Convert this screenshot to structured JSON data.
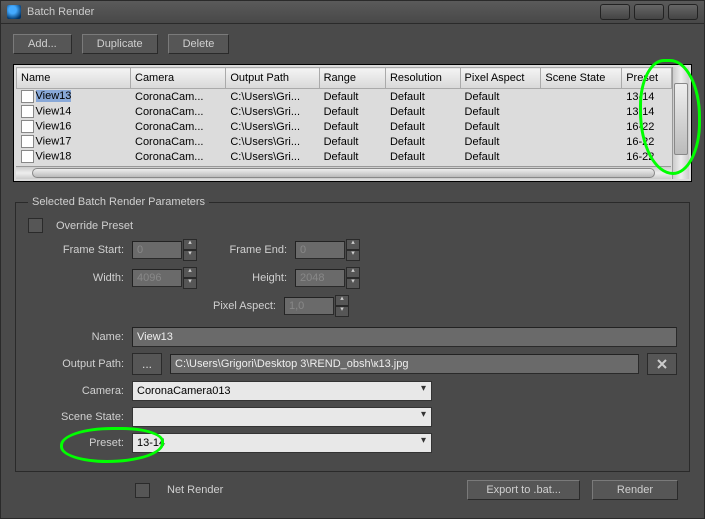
{
  "window": {
    "title": "Batch Render"
  },
  "toolbar": {
    "add": "Add...",
    "duplicate": "Duplicate",
    "delete": "Delete"
  },
  "list": {
    "headers": [
      "Name",
      "Camera",
      "Output Path",
      "Range",
      "Resolution",
      "Pixel Aspect",
      "Scene State",
      "Preset"
    ],
    "rows": [
      {
        "name": "View13",
        "camera": "CoronaCam...",
        "path": "C:\\Users\\Gri...",
        "range": "Default",
        "res": "Default",
        "pa": "Default",
        "ss": "",
        "preset": "13-14",
        "selected": true
      },
      {
        "name": "View14",
        "camera": "CoronaCam...",
        "path": "C:\\Users\\Gri...",
        "range": "Default",
        "res": "Default",
        "pa": "Default",
        "ss": "",
        "preset": "13-14",
        "selected": false
      },
      {
        "name": "View16",
        "camera": "CoronaCam...",
        "path": "C:\\Users\\Gri...",
        "range": "Default",
        "res": "Default",
        "pa": "Default",
        "ss": "",
        "preset": "16-22",
        "selected": false
      },
      {
        "name": "View17",
        "camera": "CoronaCam...",
        "path": "C:\\Users\\Gri...",
        "range": "Default",
        "res": "Default",
        "pa": "Default",
        "ss": "",
        "preset": "16-22",
        "selected": false
      },
      {
        "name": "View18",
        "camera": "CoronaCam...",
        "path": "C:\\Users\\Gri...",
        "range": "Default",
        "res": "Default",
        "pa": "Default",
        "ss": "",
        "preset": "16-22",
        "selected": false
      }
    ]
  },
  "params": {
    "legend": "Selected Batch Render Parameters",
    "override_label": "Override Preset",
    "frame_start_label": "Frame Start:",
    "frame_start": "0",
    "frame_end_label": "Frame End:",
    "frame_end": "0",
    "width_label": "Width:",
    "width": "4096",
    "height_label": "Height:",
    "height": "2048",
    "pixel_aspect_label": "Pixel Aspect:",
    "pixel_aspect": "1,0",
    "name_label": "Name:",
    "name": "View13",
    "output_path_label": "Output Path:",
    "output_path_browse": "...",
    "output_path": "C:\\Users\\Grigori\\Desktop 3\\REND_obsh\\к13.jpg",
    "camera_label": "Camera:",
    "camera": "CoronaCamera013",
    "scene_state_label": "Scene State:",
    "scene_state": "",
    "preset_label": "Preset:",
    "preset": "13-14"
  },
  "footer": {
    "net_render": "Net Render",
    "export": "Export to .bat...",
    "render": "Render"
  }
}
